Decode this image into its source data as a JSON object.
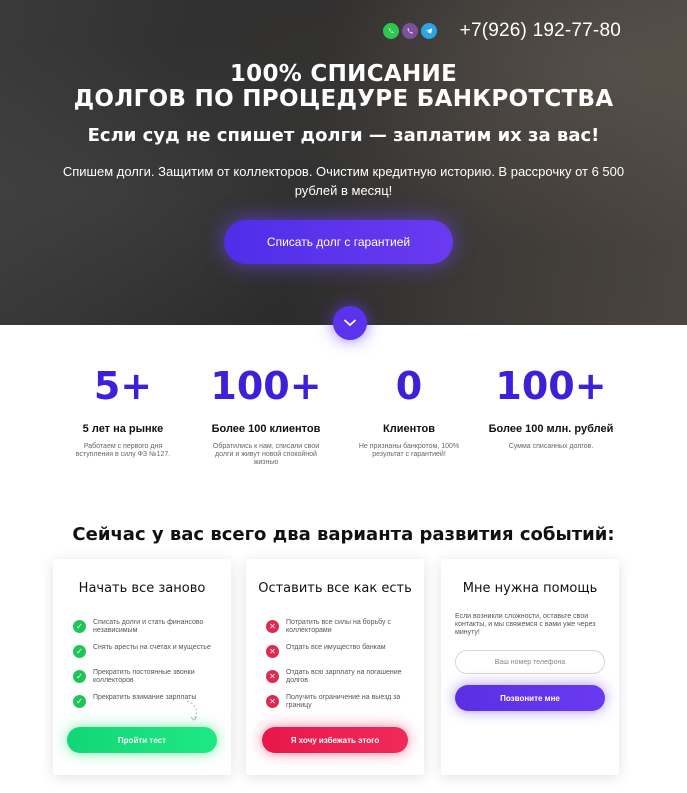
{
  "hero": {
    "contact_icons": [
      "whatsapp-icon",
      "viber-icon",
      "telegram-icon"
    ],
    "phone": "+7(926) 192-77-80",
    "title_line1": "100% СПИСАНИЕ",
    "title_line2": "ДОЛГОВ ПО ПРОЦЕДУРЕ БАНКРОТСТВА",
    "subtitle": "Если суд не спишет долги — заплатим их за вас!",
    "description": "Спишем долги. Защитим от коллекторов. Очистим кредитную историю. В рассрочку от 6 500 рублей в месяц!",
    "cta_label": "Списать долг с гарантией",
    "scroll_icon": "chevron-down-icon"
  },
  "stats": [
    {
      "value": "5+",
      "label": "5 лет на рынке",
      "desc": "Работаем с первого дня вступления в силу ФЗ №127."
    },
    {
      "value": "100+",
      "label": "Более 100 клиентов",
      "desc": "Обратились к нам, списали свои долги и живут новой спокойной жизнью"
    },
    {
      "value": "0",
      "label": "Клиентов",
      "desc": "Не признаны банкротом, 100% результат с гарантией!"
    },
    {
      "value": "100+",
      "label": "Более 100 млн. рублей",
      "desc": "Сумма списанных долгов."
    }
  ],
  "options": {
    "heading": "Сейчас у вас всего два варианта развития событий:",
    "cards": [
      {
        "title": "Начать все заново",
        "items": [
          "Списать долги и стать финансово независимым",
          "Снять аресты на счетах и мущестье",
          "Прекратить постоянные звонки коллекторов",
          "Прекратить взимание зарплаты"
        ],
        "button": "Пройти тест"
      },
      {
        "title": "Оставить все как есть",
        "items": [
          "Потратить все силы на борьбу с коллекторами",
          "Отдать все имущество банкам",
          "Отдать всю зарплату на погашение долгов",
          "Получить ограничение на выезд за границу"
        ],
        "button": "Я хочу избежать этого"
      },
      {
        "title": "Мне нужна помощь",
        "text": "Если возникли сложности, оставьте свои контакты, и мы свяжемся с вами уже через минуту!",
        "input_placeholder": "Ваш номер телефона",
        "button": "Позвоните мне"
      }
    ]
  },
  "colors": {
    "accent": "#3d20d8",
    "cta": "#5b33ec",
    "success": "#22c45a",
    "danger": "#e0294f"
  }
}
